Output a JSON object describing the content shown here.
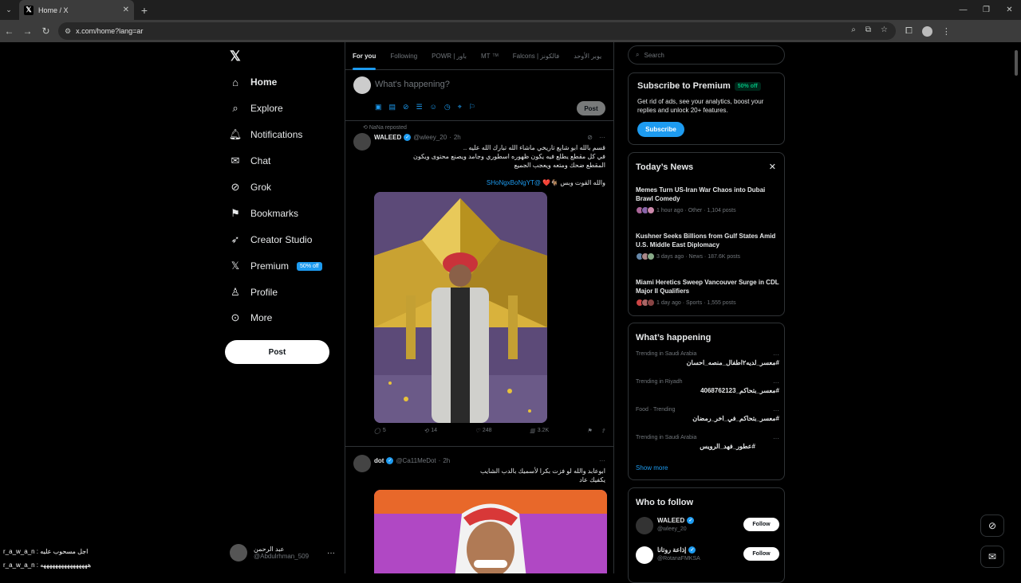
{
  "browser": {
    "tab_title": "Home / X",
    "url": "x.com/home?lang=ar"
  },
  "nav": {
    "items": [
      {
        "label": "Home",
        "icon": "home-icon"
      },
      {
        "label": "Explore",
        "icon": "search-icon"
      },
      {
        "label": "Notifications",
        "icon": "bell-icon"
      },
      {
        "label": "Chat",
        "icon": "mail-icon"
      },
      {
        "label": "Grok",
        "icon": "grok-icon"
      },
      {
        "label": "Bookmarks",
        "icon": "bookmark-icon"
      },
      {
        "label": "Creator Studio",
        "icon": "rocket-icon"
      },
      {
        "label": "Premium",
        "icon": "x-logo-icon"
      },
      {
        "label": "Profile",
        "icon": "person-icon"
      },
      {
        "label": "More",
        "icon": "more-circle-icon"
      }
    ],
    "premium_badge": "50% off",
    "post_label": "Post"
  },
  "account": {
    "name": "عبد الرحمن",
    "handle": "@Abdulrhman_509"
  },
  "feed": {
    "tabs": [
      "For you",
      "Following",
      "POWR | باور",
      "MT",
      "Falcons | فالكونز",
      "يوبر الأوحد"
    ],
    "mt_badge": "TM",
    "compose_placeholder": "What's happening?",
    "compose_post": "Post",
    "tweet1": {
      "repost_label": "NaNa reposted",
      "name": "WALEED",
      "handle": "@wleey_20",
      "time": "2h",
      "line1": "قسم بالله ابو شايع تاريخي ماشاء الله تبارك الله عليه ..",
      "line2": "في كل مقطع يطلع فيه يكون ظهوره اسطوري وجامد ويصنع محتوى ويكون",
      "line3": "المقطع ضحك ومتعه ويعجب الجميع",
      "line4": "والله القوت وبس",
      "mention": "@SHoNgxBoNgYT",
      "replies": "5",
      "reposts": "14",
      "likes": "248",
      "views": "3.2K"
    },
    "tweet2": {
      "name": "dot",
      "handle": "@Ca11MeDot",
      "time": "2h",
      "line1": "ابوعابد والله لو فزت بكرا لأسميك بالدب الشايب",
      "line2": "يكفيك عاد"
    }
  },
  "right": {
    "search_placeholder": "Search",
    "premium": {
      "title": "Subscribe to Premium",
      "badge": "50% off",
      "desc": "Get rid of ads, see your analytics, boost your replies and unlock 20+ features.",
      "button": "Subscribe"
    },
    "news": {
      "title": "Today’s News",
      "items": [
        {
          "headline": "Memes Turn US-Iran War Chaos into Dubai Brawl Comedy",
          "meta": "1 hour ago · Other · 1,104 posts"
        },
        {
          "headline": "Kushner Seeks Billions from Gulf States Amid U.S. Middle East Diplomacy",
          "meta": "3 days ago · News · 187.6K posts"
        },
        {
          "headline": "Miami Heretics Sweep Vancouver Surge in CDL Major II Qualifiers",
          "meta": "1 day ago · Sports · 1,555 posts"
        }
      ]
    },
    "happening": {
      "title": "What’s happening",
      "trends": [
        {
          "meta": "Trending in Saudi Arabia",
          "topic": "#معسر_لديه٢اطفال_منصه_احسان"
        },
        {
          "meta": "Trending in Riyadh",
          "topic": "#معسر_بتحاكم_4068762123"
        },
        {
          "meta": "Food · Trending",
          "topic": "#معسر_بتحاكم_في_اخر_رمضان"
        },
        {
          "meta": "Trending in Saudi Arabia",
          "topic": "#عطور_فهد_الرويس"
        }
      ],
      "show_more": "Show more"
    },
    "wtf": {
      "title": "Who to follow",
      "users": [
        {
          "name": "WALEED",
          "handle": "@wleey_20",
          "button": "Follow"
        },
        {
          "name": "إذاعة روتانا",
          "handle": "@RotanaFMKSA",
          "button": "Follow"
        }
      ]
    }
  },
  "overlay": {
    "line1": "r_a_w_a_n : اجل مسحوب عليه",
    "line2": "r_a_w_a_n : ههههههههههههههههه"
  }
}
